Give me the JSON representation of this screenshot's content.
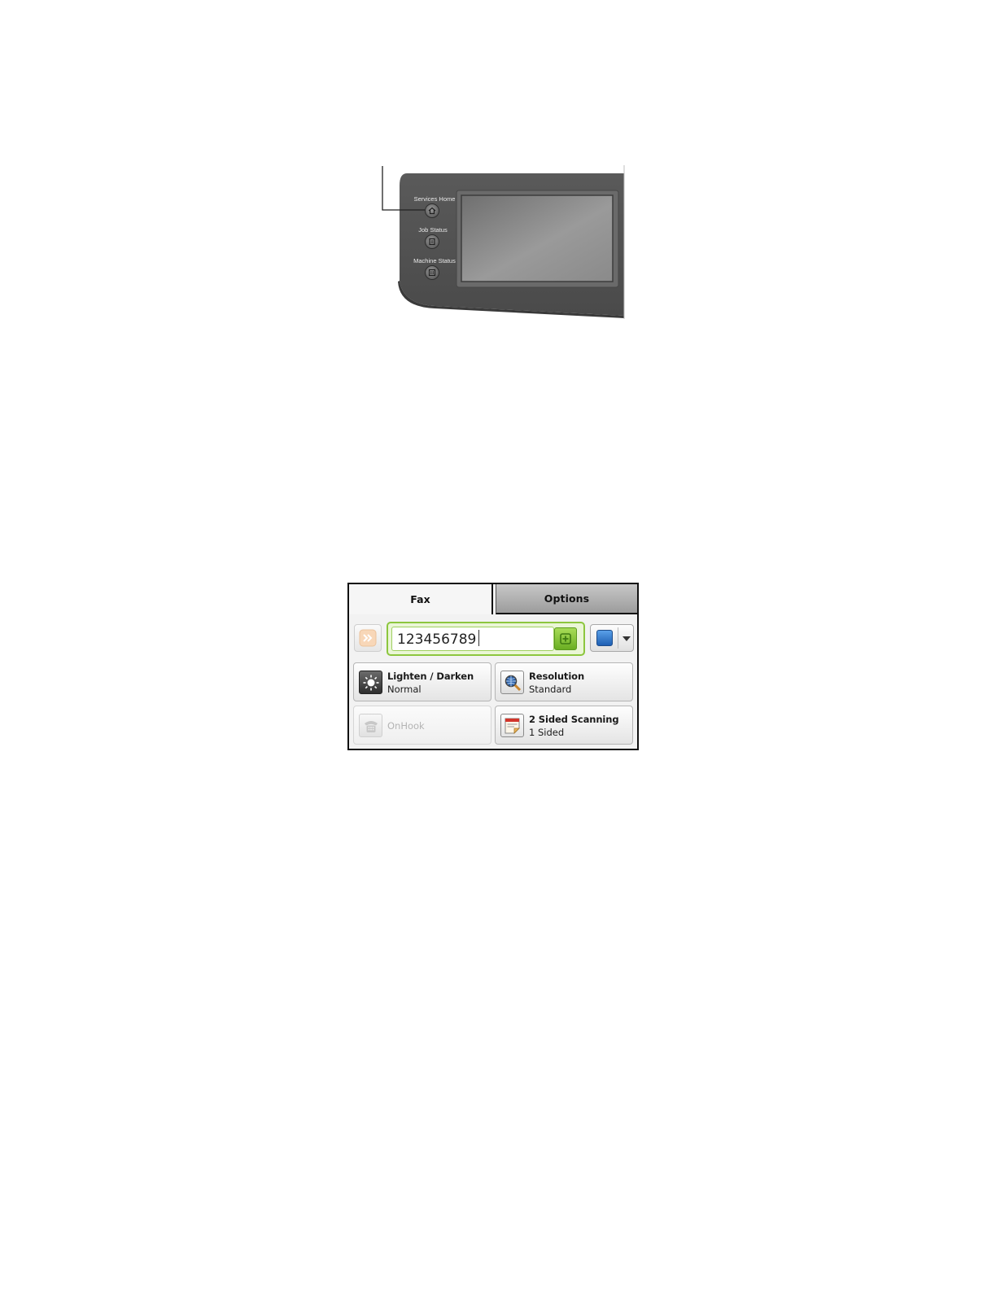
{
  "control_panel": {
    "buttons": [
      {
        "label": "Services Home",
        "icon": "home-icon"
      },
      {
        "label": "Job Status",
        "icon": "job-status-icon"
      },
      {
        "label": "Machine Status",
        "icon": "machine-status-icon"
      }
    ]
  },
  "fax_screen": {
    "tabs": [
      {
        "label": "Fax",
        "selected": true
      },
      {
        "label": "Options",
        "selected": false
      }
    ],
    "fax_number": {
      "value": "123456789"
    },
    "features": {
      "lighten_darken": {
        "title": "Lighten / Darken",
        "value": "Normal",
        "icon": "sun-icon"
      },
      "resolution": {
        "title": "Resolution",
        "value": "Standard",
        "icon": "magnifier-globe-icon"
      },
      "onhook": {
        "title": "OnHook",
        "icon": "telephone-icon",
        "enabled": false
      },
      "two_sided": {
        "title": "2 Sided Scanning",
        "value": "1 Sided",
        "icon": "two-sided-page-icon"
      }
    },
    "colors": {
      "accent_green": "#8cc63e",
      "tab_inactive": "#b3b3b3"
    }
  }
}
